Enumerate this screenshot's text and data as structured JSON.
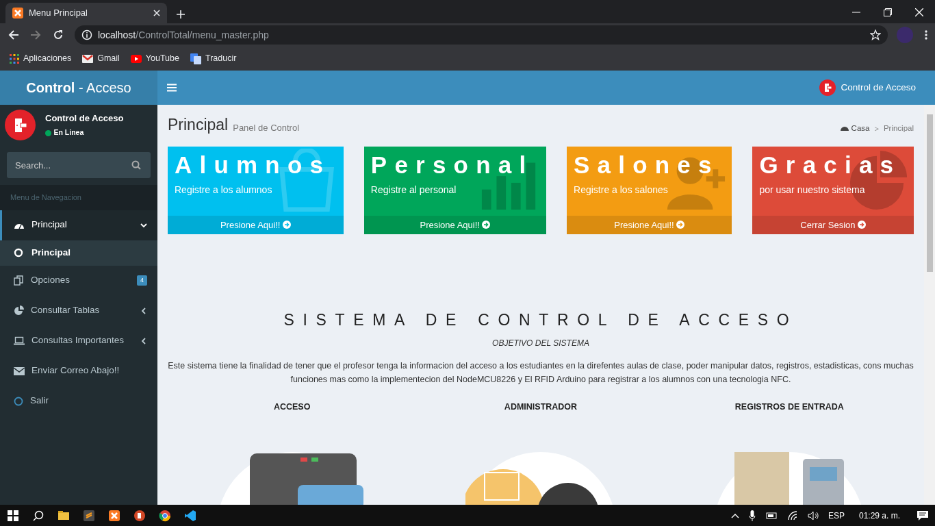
{
  "browser": {
    "tab_title": "Menu Principal",
    "url_host": "localhost",
    "url_path": "/ControlTotal/menu_master.php",
    "bookmarks": [
      {
        "label": "Aplicaciones"
      },
      {
        "label": "Gmail"
      },
      {
        "label": "YouTube"
      },
      {
        "label": "Traducir"
      }
    ]
  },
  "header": {
    "logo": "**Control** - Acceso",
    "user_menu": "Control de Acceso"
  },
  "sidebar": {
    "user_name": "Control de Acceso",
    "status": "En Linea",
    "search_placeholder": "Search...",
    "section": "Menu de Navegacion",
    "items": [
      {
        "label": "Principal",
        "selected": true,
        "expanded": true,
        "children": [
          {
            "label": "Principal",
            "selected": true
          }
        ]
      },
      {
        "label": "Opciones",
        "selected": false,
        "badge": "4"
      },
      {
        "label": "Consultar Tablas",
        "selected": false,
        "expanded": false
      },
      {
        "label": "Consultas Importantes",
        "selected": false,
        "expanded": false
      },
      {
        "label": "Enviar Correo Abajo!!",
        "selected": false
      },
      {
        "label": "Salir",
        "selected": false
      }
    ]
  },
  "content": {
    "title": "Principal",
    "subtitle": "Panel de Control",
    "breadcrumb": [
      "Casa",
      "Principal"
    ],
    "breadcrumb_separator": ">",
    "boxes": [
      {
        "title": "Alumnos",
        "text": "Registre a los alumnos",
        "link": "Presione Aqui!!",
        "color": "#00c0ef"
      },
      {
        "title": "Personal",
        "text": "Registre al personal",
        "link": "Presione Aqui!!",
        "color": "#00a65a"
      },
      {
        "title": "Salones",
        "text": "Registre a los salones",
        "link": "Presione Aqui!!",
        "color": "#f39c12"
      },
      {
        "title": "Gracias",
        "text": "por usar nuestro sistema",
        "link": "Cerrar Sesion",
        "color": "#dd4b39"
      }
    ],
    "heading": "SISTEMA DE CONTROL DE ACCESO",
    "objective": "OBJETIVO DEL SISTEMA",
    "description": "Este sistema tiene la finalidad de tener que el profesor tenga la informacion del acceso a los estudiantes en la direfentes aulas de clase, poder manipular datos, registros, estadisticas, cons muchas funciones mas como la implementecion del NodeMCU8226 y El RFID Arduino para registrar a los alumnos con una tecnologia NFC.",
    "features": [
      {
        "title": "ACCESO"
      },
      {
        "title": "ADMINISTRADOR"
      },
      {
        "title": "REGISTROS DE ENTRADA"
      }
    ]
  },
  "taskbar": {
    "language": "ESP",
    "time": "01:29 a. m."
  }
}
